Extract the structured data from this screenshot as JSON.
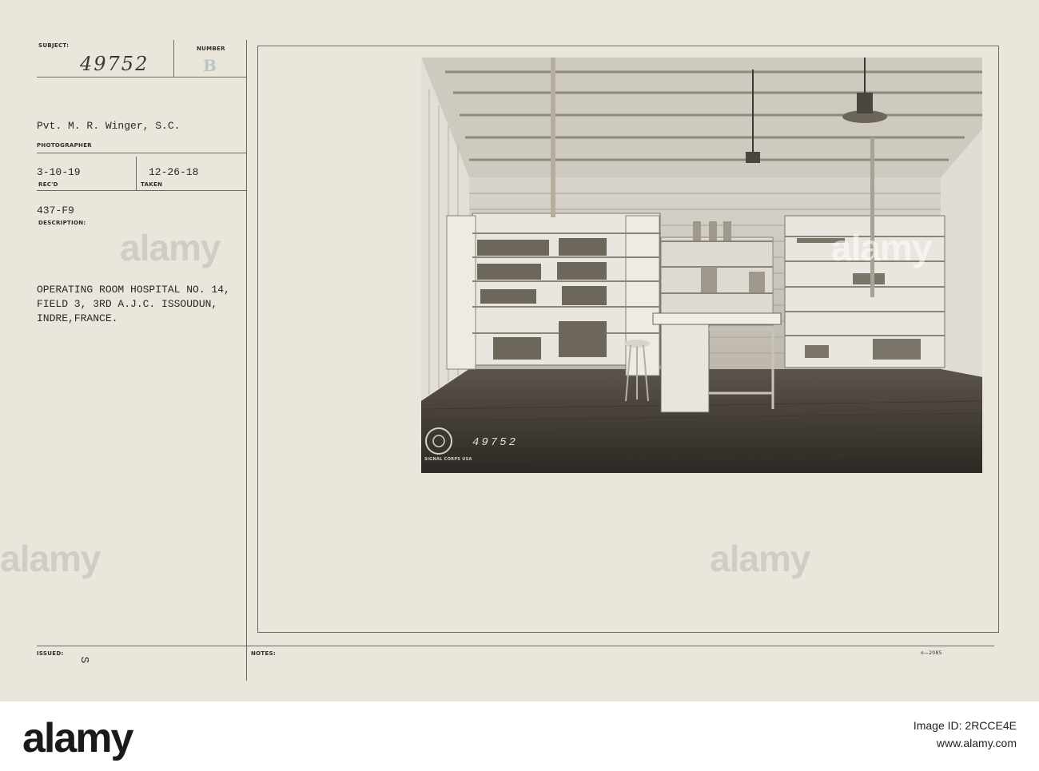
{
  "card": {
    "subject_label": "SUBJECT:",
    "subject_number": "49752",
    "number_label": "NUMBER",
    "number_value": "B",
    "photographer_name": "Pvt. M. R. Winger, S.C.",
    "photographer_label": "PHOTOGRAPHER",
    "received_date": "3-10-19",
    "received_label": "REC'D",
    "taken_date": "12-26-18",
    "taken_label": "TAKEN",
    "file_code": "437-F9",
    "description_label": "DESCRIPTION:",
    "description_line1": "OPERATING ROOM HOSPITAL NO. 14,",
    "description_line2": "FIELD 3, 3RD A.J.C. ISSOUDUN,",
    "description_line3": "INDRE,FRANCE.",
    "issued_label": "ISSUED:",
    "issued_mark": "S",
    "notes_label": "NOTES:",
    "form_code": "o—2085"
  },
  "photo": {
    "negative_number": "49752",
    "seal_text": "SIGNAL CORPS USA"
  },
  "watermark": {
    "text": "alamy"
  },
  "footer": {
    "logo": "alamy",
    "image_id_line": "Image ID: 2RCCE4E",
    "site": "www.alamy.com"
  }
}
